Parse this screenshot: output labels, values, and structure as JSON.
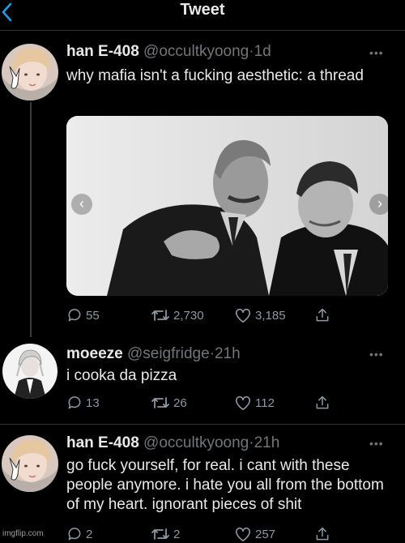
{
  "header": {
    "title": "Tweet",
    "back_icon": "chevron-left-icon"
  },
  "tweets": [
    {
      "name": "han E-408",
      "handle": "@occultkyoong",
      "time": "1d",
      "text": "why mafia isn't a fucking aesthetic: a thread",
      "replies": "55",
      "retweets": "2,730",
      "likes": "3,185",
      "has_photo": true
    },
    {
      "name": "moeeze",
      "handle": "@seigfridge",
      "time": "21h",
      "text": "i cooka da pizza",
      "replies": "13",
      "retweets": "26",
      "likes": "112"
    },
    {
      "name": "han E-408",
      "handle": "@occultkyoong",
      "time": "21h",
      "text": "go fuck yourself, for real. i cant with these people anymore. i hate you all from the bottom of my heart. ignorant pieces of shit",
      "replies": "2",
      "retweets": "2",
      "likes": "257"
    }
  ],
  "separator": "·",
  "watermark": "imgflip.com",
  "colors": {
    "background": "#000000",
    "accent": "#1d9bf0",
    "secondary_text": "#71767b"
  }
}
